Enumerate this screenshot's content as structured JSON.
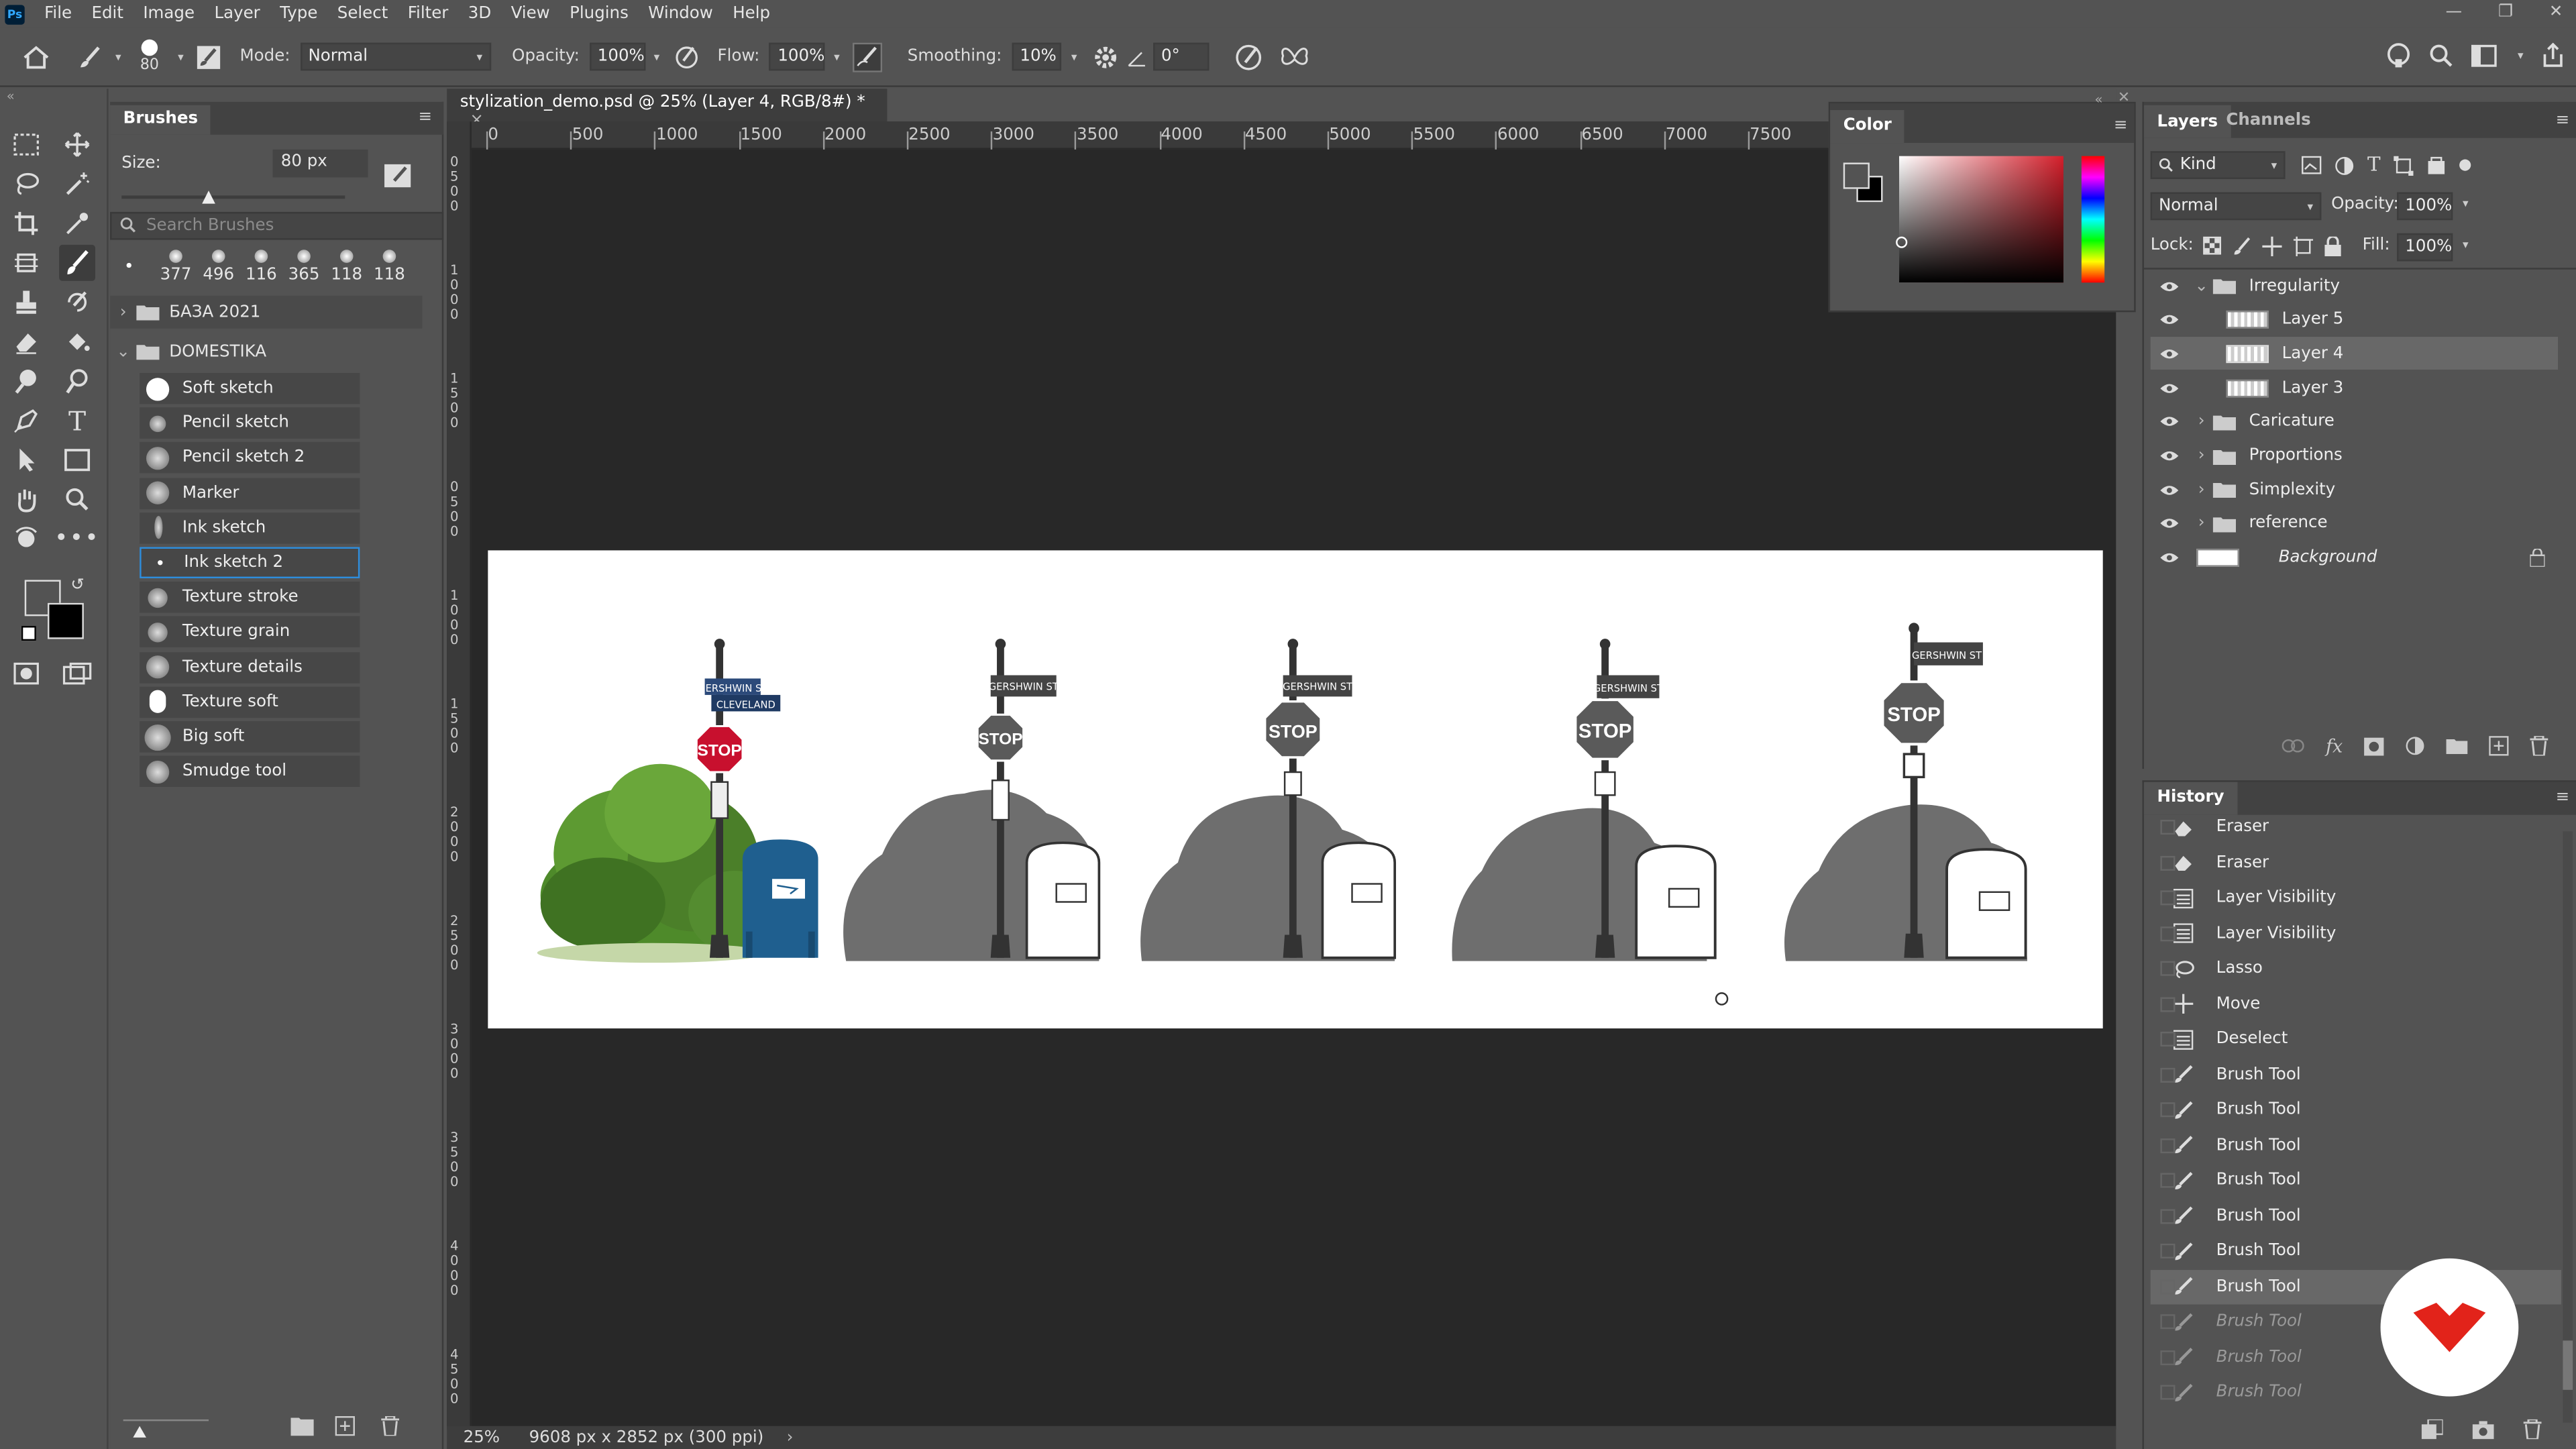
{
  "app": {
    "logo": "Ps",
    "menu": [
      "File",
      "Edit",
      "Image",
      "Layer",
      "Type",
      "Select",
      "Filter",
      "3D",
      "View",
      "Plugins",
      "Window",
      "Help"
    ],
    "window_controls": [
      "—",
      "❐",
      "✕"
    ]
  },
  "options": {
    "brush_size": "80",
    "mode_label": "Mode:",
    "mode_value": "Normal",
    "opacity_label": "Opacity:",
    "opacity_value": "100%",
    "flow_label": "Flow:",
    "flow_value": "100%",
    "smoothing_label": "Smoothing:",
    "smoothing_value": "10%",
    "angle_value": "0°"
  },
  "brushes": {
    "title": "Brushes",
    "size_label": "Size:",
    "size_value": "80 px",
    "search_placeholder": "Search Brushes",
    "preset_sizes": [
      "377",
      "496",
      "116",
      "365",
      "118",
      "118"
    ],
    "groups": [
      {
        "name": "БАЗА 2021"
      },
      {
        "name": "DOMESTIKA"
      }
    ],
    "items": [
      {
        "label": "Soft sketch"
      },
      {
        "label": "Pencil sketch"
      },
      {
        "label": "Pencil sketch 2"
      },
      {
        "label": "Marker"
      },
      {
        "label": "Ink sketch"
      },
      {
        "label": "Ink sketch 2",
        "selected": true
      },
      {
        "label": "Texture stroke"
      },
      {
        "label": "Texture grain"
      },
      {
        "label": "Texture details"
      },
      {
        "label": "Texture soft"
      },
      {
        "label": "Big soft"
      },
      {
        "label": "Smudge tool"
      }
    ]
  },
  "document": {
    "tab_title": "stylization_demo.psd @ 25% (Layer 4, RGB/8#) *",
    "close": "×",
    "ruler_marks": [
      "0",
      "500",
      "1000",
      "1500",
      "2000",
      "2500",
      "3000",
      "3500",
      "4000",
      "4500",
      "5000",
      "5500",
      "6000",
      "6500",
      "7000",
      "7500"
    ],
    "zoom": "25%",
    "doc_info": "9608 px x 2852 px (300 ppi)",
    "status_arrow": "›",
    "illustration": {
      "stop_text": "STOP",
      "street_sign_text": "GERSHWIN ST",
      "street_sign_text_2": "CLEVELAND"
    }
  },
  "left_ruler": [
    "0",
    "5",
    "0",
    "0",
    "1",
    "0",
    "0",
    "0",
    "1",
    "5",
    "0",
    "0",
    "0",
    "5",
    "0",
    "0",
    "1",
    "0",
    "0",
    "0",
    "1",
    "5",
    "0",
    "0",
    "2",
    "0",
    "0",
    "0",
    "2",
    "5",
    "0",
    "0",
    "3",
    "0",
    "0",
    "0",
    "3",
    "5",
    "0",
    "0",
    "4",
    "0",
    "0",
    "0",
    "4",
    "5",
    "0",
    "0"
  ],
  "color_panel": {
    "title": "Color",
    "fg": "#535353",
    "bg": "#000000",
    "hue": "#d41f2b"
  },
  "layers": {
    "tabs": [
      "Layers",
      "Channels"
    ],
    "filter_kind": "Kind",
    "blend": "Normal",
    "opacity_label": "Opacity:",
    "opacity_value": "100%",
    "lock_label": "Lock:",
    "fill_label": "Fill:",
    "fill_value": "100%",
    "items": [
      {
        "name": "Irregularity",
        "type": "group",
        "expanded": true
      },
      {
        "name": "Layer 5",
        "type": "layer"
      },
      {
        "name": "Layer 4",
        "type": "layer",
        "selected": true
      },
      {
        "name": "Layer 3",
        "type": "layer"
      },
      {
        "name": "Caricature",
        "type": "group"
      },
      {
        "name": "Proportions",
        "type": "group"
      },
      {
        "name": "Simplexity",
        "type": "group"
      },
      {
        "name": "reference",
        "type": "group"
      },
      {
        "name": "Background",
        "type": "background",
        "locked": true
      }
    ]
  },
  "history": {
    "title": "History",
    "items": [
      {
        "label": "Eraser",
        "icon": "eraser-icon"
      },
      {
        "label": "Eraser",
        "icon": "eraser-icon"
      },
      {
        "label": "Layer Visibility",
        "icon": "layer-icon"
      },
      {
        "label": "Layer Visibility",
        "icon": "layer-icon"
      },
      {
        "label": "Lasso",
        "icon": "lasso-icon"
      },
      {
        "label": "Move",
        "icon": "move-icon"
      },
      {
        "label": "Deselect",
        "icon": "layer-icon"
      },
      {
        "label": "Brush Tool",
        "icon": "brush-icon"
      },
      {
        "label": "Brush Tool",
        "icon": "brush-icon"
      },
      {
        "label": "Brush Tool",
        "icon": "brush-icon"
      },
      {
        "label": "Brush Tool",
        "icon": "brush-icon"
      },
      {
        "label": "Brush Tool",
        "icon": "brush-icon"
      },
      {
        "label": "Brush Tool",
        "icon": "brush-icon"
      },
      {
        "label": "Brush Tool",
        "icon": "brush-icon",
        "selected": true
      },
      {
        "label": "Brush Tool",
        "icon": "brush-icon",
        "dimmed": true
      },
      {
        "label": "Brush Tool",
        "icon": "brush-icon",
        "dimmed": true
      },
      {
        "label": "Brush Tool",
        "icon": "brush-icon",
        "dimmed": true
      }
    ]
  },
  "colors": {
    "accent": "#2e8ddc",
    "domestika": "#e2231a",
    "stop_red": "#c8102e",
    "mailbox_blue": "#1f5f8f",
    "bush_green": "#4e8a2a"
  }
}
